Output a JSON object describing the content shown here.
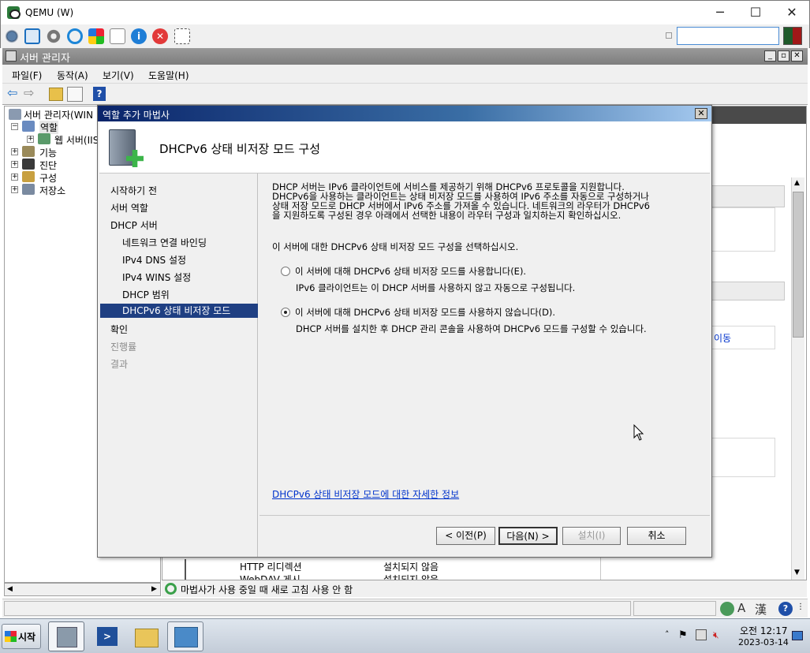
{
  "qemu": {
    "title": "QEMU (W)",
    "controls": {
      "minimize": "─",
      "maximize": "☐",
      "close": "✕"
    }
  },
  "server_manager": {
    "title": "서버 관리자",
    "menu": [
      "파일(F)",
      "동작(A)",
      "보기(V)",
      "도움말(H)"
    ],
    "tree": {
      "root": "서버 관리자(WIN",
      "roles": "역할",
      "web_server": "웹 서버(IIS",
      "features": "기능",
      "diagnostics": "진단",
      "configuration": "구성",
      "storage": "저장소"
    },
    "right_pane": {
      "row1_name": "HTTP 리디렉션",
      "row1_status": "설치되지 않음",
      "row2_name": "WebDAV 게시",
      "row2_status": "설치되지 않음",
      "side_link_fragment": "이동"
    },
    "status_bar": "마법사가 사용 중일 때 새로 고침 사용 안 함"
  },
  "wizard": {
    "title": "역할 추가 마법사",
    "heading": "DHCPv6 상태 비저장 모드 구성",
    "nav": [
      {
        "label": "시작하기 전",
        "level": 0,
        "state": "normal"
      },
      {
        "label": "서버 역할",
        "level": 0,
        "state": "normal"
      },
      {
        "label": "DHCP 서버",
        "level": 0,
        "state": "normal"
      },
      {
        "label": "네트워크 연결 바인딩",
        "level": 1,
        "state": "normal"
      },
      {
        "label": "IPv4 DNS 설정",
        "level": 1,
        "state": "normal"
      },
      {
        "label": "IPv4 WINS 설정",
        "level": 1,
        "state": "normal"
      },
      {
        "label": "DHCP 범위",
        "level": 1,
        "state": "normal"
      },
      {
        "label": "DHCPv6 상태 비저장 모드",
        "level": 1,
        "state": "active"
      },
      {
        "label": "확인",
        "level": 0,
        "state": "normal"
      },
      {
        "label": "진행률",
        "level": 0,
        "state": "dim"
      },
      {
        "label": "결과",
        "level": 0,
        "state": "dim"
      }
    ],
    "description": [
      "DHCP 서버는 IPv6 클라이언트에 서비스를 제공하기 위해 DHCPv6 프로토콜을 지원합니다.",
      "DHCPv6을 사용하는 클라이언트는 상태 비저장 모드를 사용하여 IPv6 주소를 자동으로 구성하거나",
      "상태 저장 모드로 DHCP 서버에서 IPv6 주소를 가져올 수 있습니다. 네트워크의 라우터가 DHCPv6",
      "을 지원하도록 구성된 경우 아래에서 선택한 내용이 라우터 구성과 일치하는지 확인하십시오."
    ],
    "prompt": "이 서버에 대한 DHCPv6 상태 비저장 모드 구성을 선택하십시오.",
    "option_enable": {
      "label": "이 서버에 대해 DHCPv6 상태 비저장 모드를 사용합니다(E).",
      "detail": "IPv6 클라이언트는 이 DHCP 서버를 사용하지 않고 자동으로 구성됩니다.",
      "checked": false
    },
    "option_disable": {
      "label": "이 서버에 대해 DHCPv6 상태 비저장 모드를 사용하지 않습니다(D).",
      "detail": "DHCP 서버를 설치한 후 DHCP 관리 콘솔을 사용하여 DHCPv6 모드를 구성할 수 있습니다.",
      "checked": true
    },
    "more_info_link": "DHCPv6 상태 비저장 모드에 대한 자세한 정보",
    "buttons": {
      "back": "< 이전(P)",
      "next": "다음(N) >",
      "install": "설치(I)",
      "cancel": "취소"
    }
  },
  "taskbar": {
    "start": "시작",
    "clock_time": "오전 12:17",
    "clock_date": "2023-03-14"
  }
}
